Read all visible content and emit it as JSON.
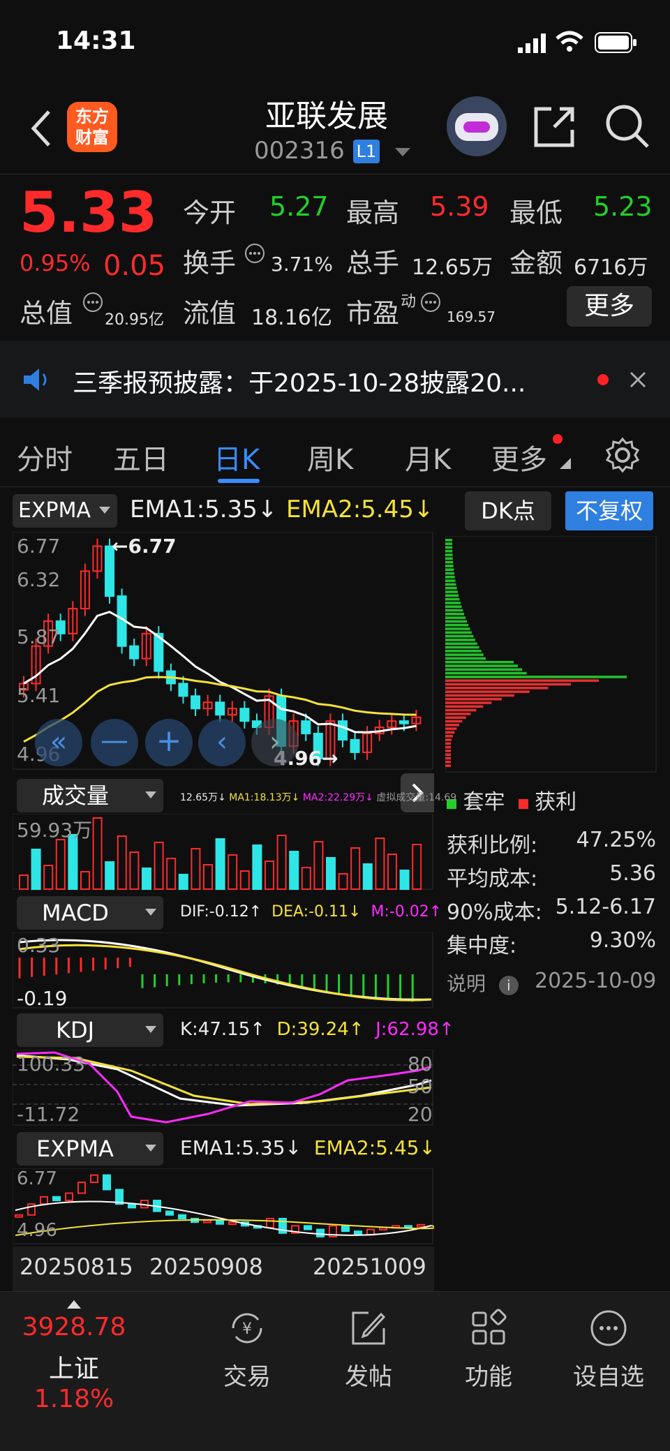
{
  "status_bar": {
    "time": "14:31"
  },
  "header": {
    "title": "亚联发展",
    "code": "002316",
    "level_badge": "L1",
    "app_logo_text": [
      "东方",
      "财富"
    ]
  },
  "quote": {
    "price": "5.33",
    "change_pct": "0.95%",
    "change": "0.05",
    "open_label": "今开",
    "open": "5.27",
    "high_label": "最高",
    "high": "5.39",
    "low_label": "最低",
    "low": "5.23",
    "turnover_label": "换手",
    "turnover": "3.71%",
    "volume_label": "总手",
    "volume": "12.65万",
    "amount_label": "金额",
    "amount": "6716万",
    "mcap_label": "总值",
    "mcap": "20.95亿",
    "float_label": "流值",
    "float_cap": "18.16亿",
    "pe_label": "市盈",
    "pe_sup": "动",
    "pe": "169.57",
    "more_button": "更多"
  },
  "notice": {
    "text": "三季报预披露：于2025-10-28披露20..."
  },
  "tabs": [
    {
      "label": "分时",
      "active": false
    },
    {
      "label": "五日",
      "active": false
    },
    {
      "label": "日K",
      "active": true
    },
    {
      "label": "周K",
      "active": false
    },
    {
      "label": "月K",
      "active": false
    },
    {
      "label": "更多",
      "active": false
    }
  ],
  "main_chart": {
    "indicator": "EXPMA",
    "ema1": "EMA1:5.35↓",
    "ema2": "EMA2:5.45↓",
    "dk_button": "DK点",
    "fq_button": "不复权",
    "y_labels": [
      "6.77",
      "6.32",
      "5.87",
      "5.41",
      "4.96"
    ],
    "high_marker": "←6.77",
    "low_marker": "4.96→"
  },
  "chip": {
    "legend_trapped": "套牢",
    "legend_profit": "获利",
    "rows": [
      {
        "label": "获利比例:",
        "value": "47.25%"
      },
      {
        "label": "平均成本:",
        "value": "5.36"
      },
      {
        "label": "90%成本:",
        "value": "5.12-6.17"
      },
      {
        "label": "集中度:",
        "value": "9.30%"
      }
    ],
    "note_label": "说明",
    "date": "2025-10-09"
  },
  "volume_panel": {
    "indicator": "成交量",
    "vol": "12.65万↓",
    "ma1": "MA1:18.13万↓",
    "ma2": "MA2:22.29万↓",
    "virtual": "虚拟成交量:14.69",
    "max_label": "59.93万"
  },
  "macd_panel": {
    "indicator": "MACD",
    "dif": "DIF:-0.12↑",
    "dea": "DEA:-0.11↓",
    "m": "M:-0.02↑",
    "top": "0.33",
    "bottom": "-0.19"
  },
  "kdj_panel": {
    "indicator": "KDJ",
    "k": "K:47.15↑",
    "d": "D:39.24↑",
    "j": "J:62.98↑",
    "top": "100.33",
    "bottom": "-11.72",
    "lv80": "80",
    "lv50": "50",
    "lv20": "20"
  },
  "expma_panel": {
    "indicator": "EXPMA",
    "ema1": "EMA1:5.35↓",
    "ema2": "EMA2:5.45↓",
    "top": "6.77",
    "bottom": "4.96"
  },
  "dates": [
    "20250815",
    "20250908",
    "20251009"
  ],
  "bottom_nav": {
    "index_value": "3928.78",
    "index_name": "上证",
    "index_change": "1.18%",
    "items": [
      {
        "label": "交易",
        "icon": "yuan-swap-icon"
      },
      {
        "label": "发帖",
        "icon": "edit-icon"
      },
      {
        "label": "功能",
        "icon": "grid-icon"
      },
      {
        "label": "设自选",
        "icon": "more-dots-icon"
      }
    ]
  },
  "colors": {
    "up": "#ff2b2b",
    "down": "#22d02a",
    "candle_down": "#2ee6e6",
    "ema1": "#ffffff",
    "ema2": "#f5e23a",
    "accent": "#2f7fe0"
  }
}
